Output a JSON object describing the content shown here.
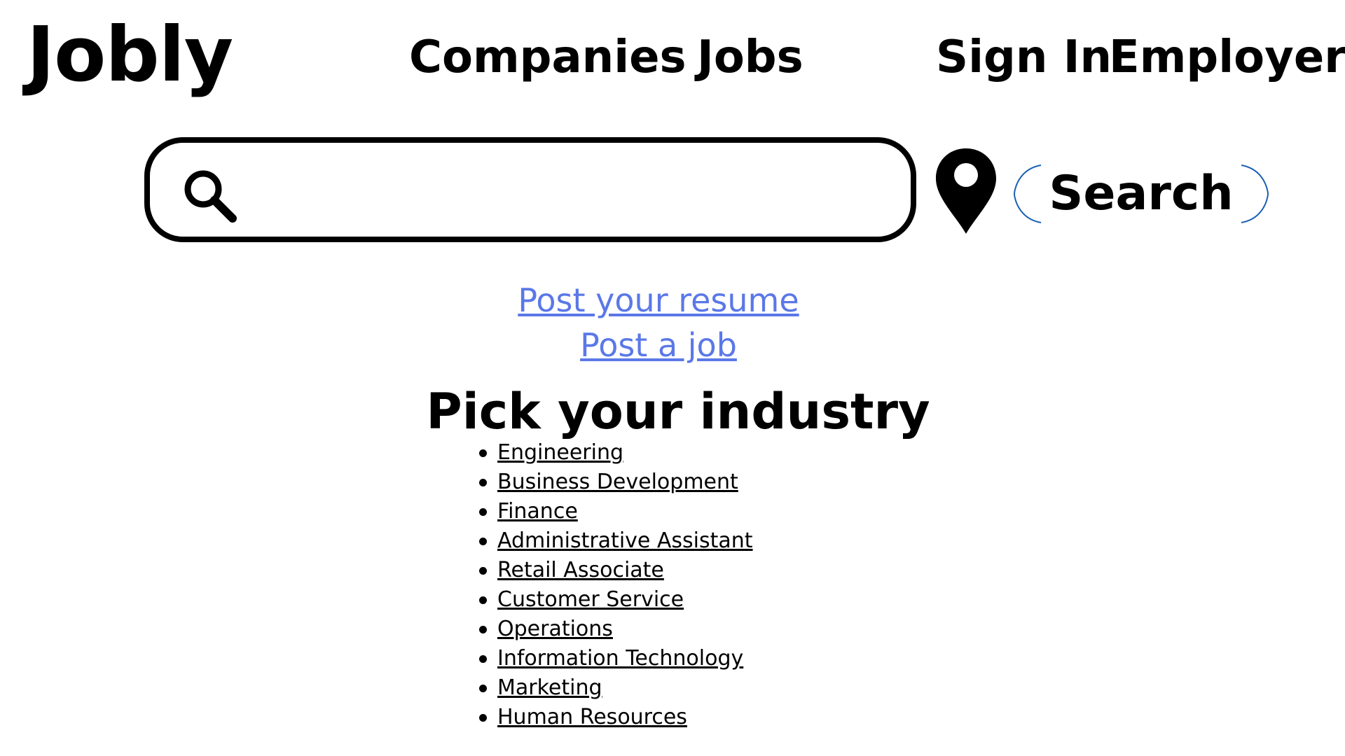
{
  "header": {
    "logo": "Jobly",
    "nav": {
      "companies": "Companies",
      "jobs": "Jobs",
      "sign_in": "Sign In",
      "employer": "Employer"
    }
  },
  "search": {
    "value": "",
    "search_icon": "magnifier-icon",
    "location_icon": "map-pin-icon",
    "button_label": "Search",
    "button_bracket_color": "#1a5fb4"
  },
  "post_links": {
    "resume": "Post your resume",
    "job": "Post a job",
    "link_color": "#5b78e8"
  },
  "industries": {
    "heading": "Pick your industry",
    "items": [
      "Engineering",
      "Business Development",
      "Finance",
      "Administrative Assistant",
      "Retail Associate",
      "Customer Service",
      "Operations",
      "Information Technology",
      "Marketing",
      "Human Resources"
    ]
  }
}
